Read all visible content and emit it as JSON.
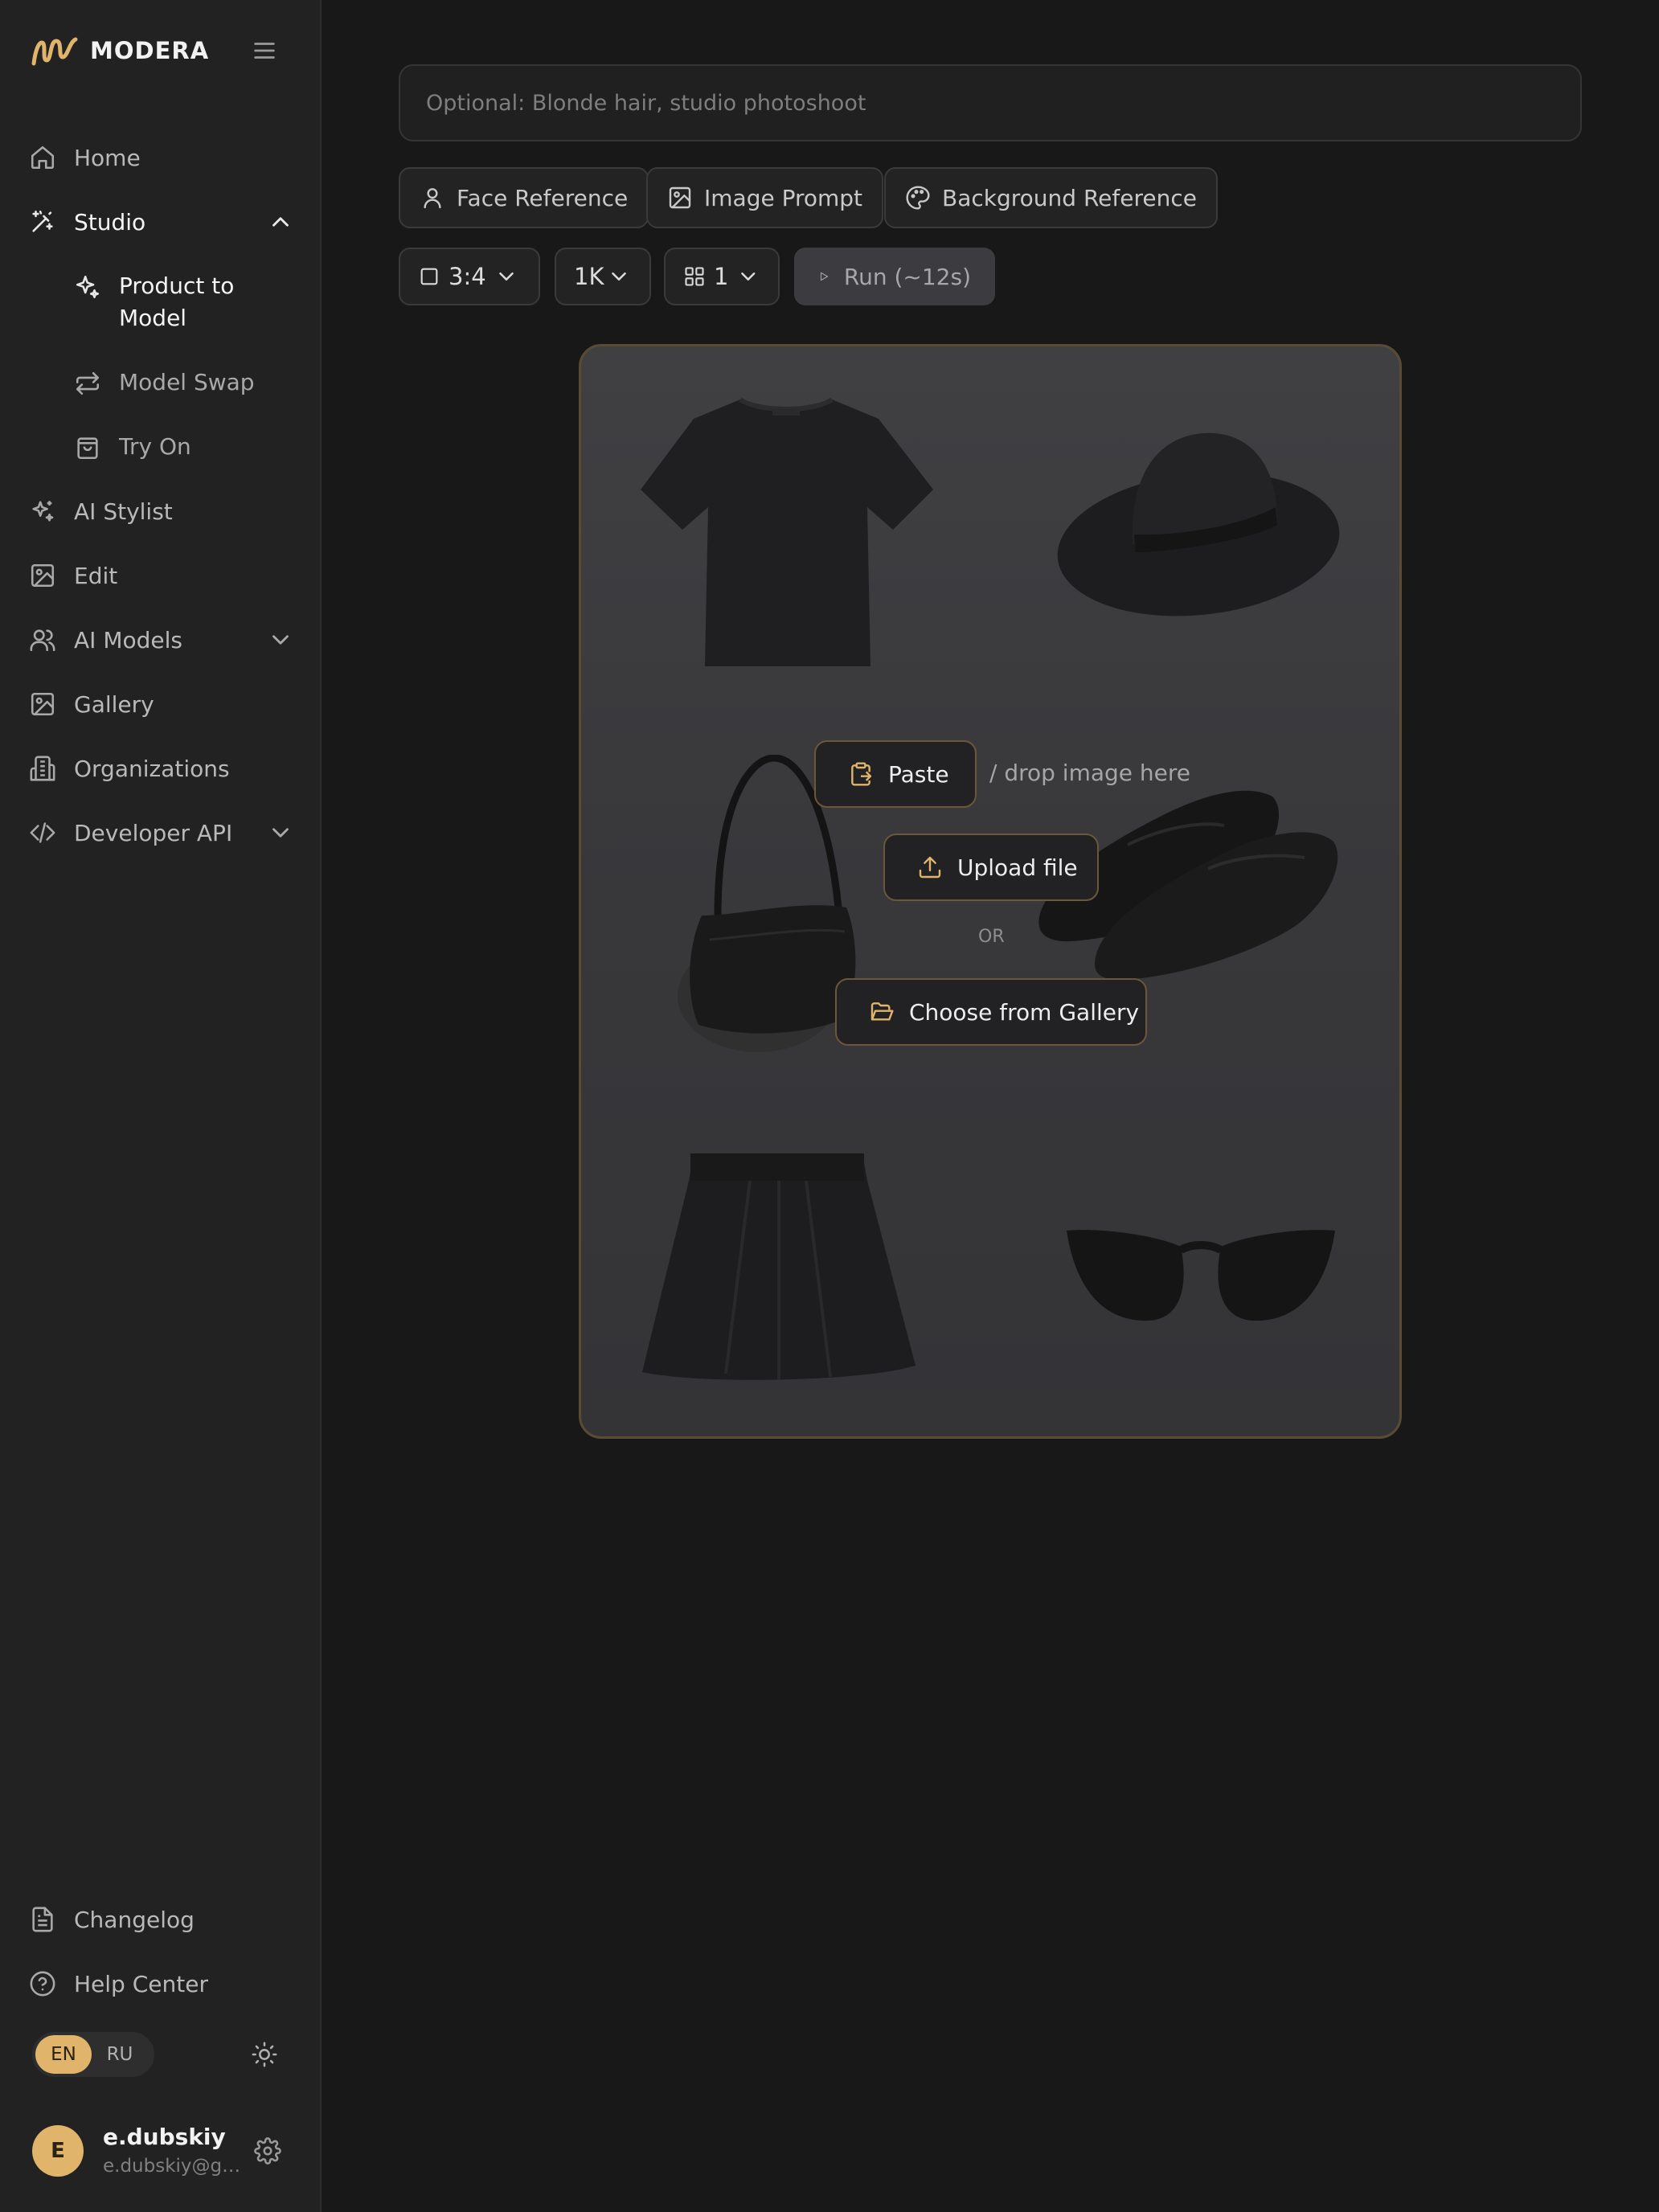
{
  "brand": {
    "name": "MODERA",
    "accent": "#e0b46a"
  },
  "sidebar": {
    "nav": [
      {
        "label": "Home",
        "icon": "home-icon"
      },
      {
        "label": "Studio",
        "icon": "magic-wand-icon"
      },
      {
        "label": "AI Stylist",
        "icon": "sparkles-icon"
      },
      {
        "label": "Edit",
        "icon": "image-edit-icon"
      },
      {
        "label": "AI Models",
        "icon": "users-icon"
      },
      {
        "label": "Gallery",
        "icon": "image-icon"
      },
      {
        "label": "Organizations",
        "icon": "building-icon"
      },
      {
        "label": "Developer API",
        "icon": "code-icon"
      }
    ],
    "studio_sub": [
      {
        "label": "Product to Model",
        "icon": "sparkles-icon"
      },
      {
        "label": "Model Swap",
        "icon": "swap-icon"
      },
      {
        "label": "Try On",
        "icon": "shopping-bag-icon"
      }
    ],
    "footer": [
      {
        "label": "Changelog",
        "icon": "document-icon"
      },
      {
        "label": "Help Center",
        "icon": "help-circle-icon"
      }
    ],
    "lang": {
      "en": "EN",
      "ru": "RU",
      "selected": "EN"
    },
    "user": {
      "initial": "E",
      "name": "e.dubskiy",
      "email": "e.dubskiy@gm..."
    }
  },
  "main": {
    "prompt_placeholder": "Optional: Blonde hair, studio photoshoot",
    "references": {
      "face": "Face Reference",
      "image": "Image Prompt",
      "background": "Background Reference"
    },
    "controls": {
      "aspect": "3:4",
      "resolution": "1K",
      "count": "1",
      "run": "Run (~12s)"
    },
    "drop": {
      "paste": "Paste",
      "drop_hint": "/ drop image here",
      "upload": "Upload file",
      "or": "OR",
      "gallery": "Choose from Gallery"
    }
  }
}
